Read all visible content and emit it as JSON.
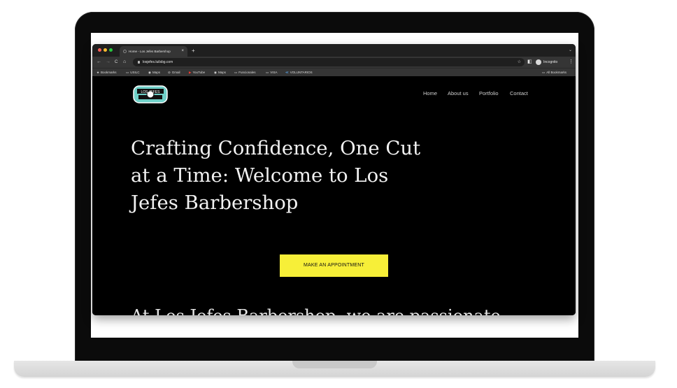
{
  "browser": {
    "tab_title": "Home - Los Jefes Barbershop",
    "tab_close": "×",
    "new_tab": "+",
    "tab_menu": "⌄",
    "url": "losjefes.luilsbg.com",
    "profile": "Incognito",
    "nav": {
      "back": "←",
      "forward": "→",
      "reload": "C",
      "home": "⌂"
    },
    "star": "☆",
    "menu": "⋮",
    "sidepanel": "◧",
    "bookmarks": [
      {
        "label": "Bookmarks",
        "icon": "★"
      },
      {
        "label": "USILC",
        "icon": "▭"
      },
      {
        "label": "Maps",
        "icon": "◉"
      },
      {
        "label": "Gmail",
        "icon": "⊘"
      },
      {
        "label": "YouTube",
        "icon": "▶"
      },
      {
        "label": "Maps",
        "icon": "◉"
      },
      {
        "label": "Funcionales",
        "icon": "▭"
      },
      {
        "label": "VISA",
        "icon": "▭"
      },
      {
        "label": "VOLUNTARIOS",
        "icon": "≪"
      }
    ],
    "all_bookmarks": "All Bookmarks",
    "colors": {
      "close": "#ff5f57",
      "minimize": "#febc2e",
      "maximize": "#28c840"
    }
  },
  "site": {
    "logo_text": "LOS JEFES",
    "nav": [
      "Home",
      "About us",
      "Portfolio",
      "Contact"
    ],
    "headline": "Crafting Confidence, One Cut at a Time: Welcome to Los Jefes Barbershop",
    "cta": "MAKE AN APPOINTMENT",
    "subtext": "At Los Jefes Barbershop, we are passionate",
    "accent": "#f7ef38"
  }
}
